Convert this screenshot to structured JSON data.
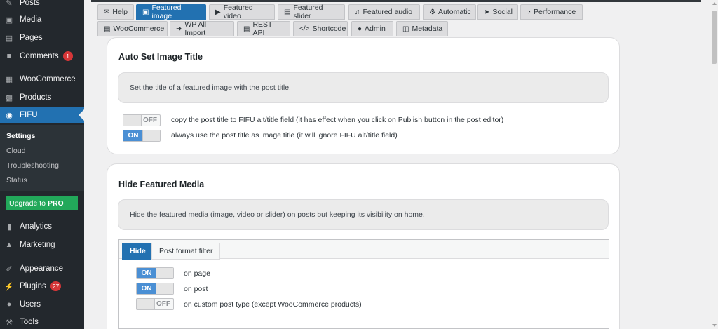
{
  "sidebar": {
    "items": [
      {
        "label": "Posts",
        "icon": "pin-icon"
      },
      {
        "label": "Media",
        "icon": "media-icon"
      },
      {
        "label": "Pages",
        "icon": "page-icon"
      },
      {
        "label": "Comments",
        "icon": "comment-icon",
        "badge": "1"
      },
      {
        "label": "WooCommerce",
        "icon": "woocommerce-icon"
      },
      {
        "label": "Products",
        "icon": "archive-icon"
      },
      {
        "label": "FIFU",
        "icon": "camera-icon"
      },
      {
        "label": "Analytics",
        "icon": "bar-chart-icon"
      },
      {
        "label": "Marketing",
        "icon": "megaphone-icon"
      },
      {
        "label": "Appearance",
        "icon": "paintbrush-icon"
      },
      {
        "label": "Plugins",
        "icon": "plugin-icon",
        "badge": "27"
      },
      {
        "label": "Users",
        "icon": "users-icon"
      },
      {
        "label": "Tools",
        "icon": "wrench-icon"
      }
    ],
    "submenu": [
      "Settings",
      "Cloud",
      "Troubleshooting",
      "Status"
    ],
    "upgrade": {
      "text": "Upgrade to",
      "pro": "PRO"
    }
  },
  "tabs_row1": [
    {
      "label": "Help",
      "icon": "envelope-icon"
    },
    {
      "label": "Featured image",
      "icon": "image-icon"
    },
    {
      "label": "Featured video",
      "icon": "play-icon"
    },
    {
      "label": "Featured slider",
      "icon": "images-icon"
    },
    {
      "label": "Featured audio",
      "icon": "volume-icon"
    },
    {
      "label": "Automatic",
      "icon": "robot-icon"
    },
    {
      "label": "Social",
      "icon": "share-icon"
    },
    {
      "label": "Performance",
      "icon": "tachometer-icon"
    }
  ],
  "tabs_row2": [
    {
      "label": "WooCommerce",
      "icon": "cart-icon"
    },
    {
      "label": "WP All Import",
      "icon": "import-icon"
    },
    {
      "label": "REST API",
      "icon": "server-icon"
    },
    {
      "label": "Shortcode",
      "icon": "code-icon"
    },
    {
      "label": "Admin",
      "icon": "user-cog-icon"
    },
    {
      "label": "Metadata",
      "icon": "database-icon"
    }
  ],
  "section1": {
    "title": "Auto Set Image Title",
    "description": "Set the title of a featured image with the post title.",
    "options": [
      {
        "state": "OFF",
        "label": "copy the post title to FIFU alt/title field (it has effect when you click on Publish button in the post editor)"
      },
      {
        "state": "ON",
        "label": "always use the post title as image title (it will ignore FIFU alt/title field)"
      }
    ]
  },
  "section2": {
    "title": "Hide Featured Media",
    "description": "Hide the featured media (image, video or slider) on posts but keeping its visibility on home.",
    "inner_tabs": [
      "Hide",
      "Post format filter"
    ],
    "options": [
      {
        "state": "ON",
        "label": "on page"
      },
      {
        "state": "ON",
        "label": "on post"
      },
      {
        "state": "OFF",
        "label": "on custom post type (except WooCommerce products)"
      }
    ]
  },
  "colors": {
    "accent": "#2271b1",
    "sidebar": "#23282d",
    "upgrade": "#22a85a",
    "badge": "#d63638"
  }
}
